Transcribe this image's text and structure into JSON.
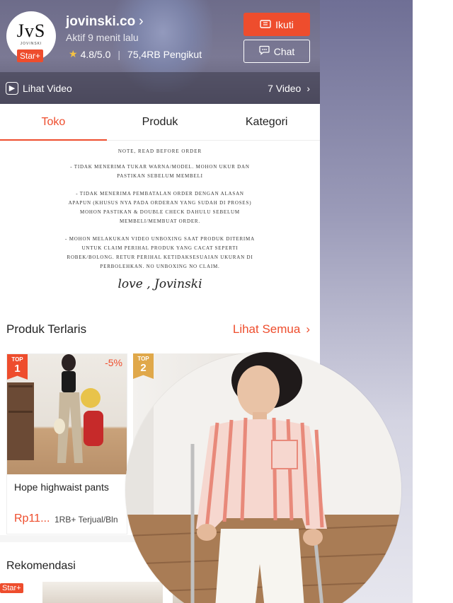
{
  "shop": {
    "logo_text": "JvS",
    "logo_sub": "JOVINSKI",
    "star_badge": "Star+",
    "name": "jovinski.co",
    "active_status": "Aktif 9 menit lalu",
    "rating": "4.8/5.0",
    "followers": "75,4RB Pengikut",
    "follow_label": "Ikuti",
    "chat_label": "Chat",
    "video_link": "Lihat Video",
    "video_count": "7 Video"
  },
  "tabs": [
    {
      "label": "Toko",
      "active": true
    },
    {
      "label": "Produk",
      "active": false
    },
    {
      "label": "Kategori",
      "active": false
    }
  ],
  "notice": {
    "title": "NOTE, READ BEFORE ORDER",
    "p1": "- TIDAK MENERIMA TUKAR WARNA/MODEL. MOHON UKUR DAN PASTIKAN SEBELUM MEMBELI",
    "p2": "- TIDAK MENERIMA PEMBATALAN ORDER DENGAN ALASAN APAPUN (KHUSUS NYA PADA ORDERAN YANG SUDAH DI PROSES) MOHON PASTIKAN & DOUBLE CHECK DAHULU SEBELUM MEMBELI/MEMBUAT ORDER.",
    "p3": "- MOHON MELAKUKAN VIDEO UNBOXING SAAT PRODUK DITERIMA UNTUK CLAIM PERIHAL PRODUK YANG CACAT SEPERTI ROBEK/BOLONG. RETUR PERIHAL KETIDAKSESUAIAN UKURAN DI PERBOLEHKAN. NO UNBOXING NO CLAIM.",
    "signature": "love , Jovinski"
  },
  "best_sellers": {
    "title": "Produk Terlaris",
    "see_all": "Lihat Semua",
    "products": [
      {
        "badge_top": "TOP",
        "badge_rank": "1",
        "discount": "-5%",
        "name": "Hope highwaist pants",
        "price": "Rp11...",
        "sold": "1RB+ Terjual/Bln"
      },
      {
        "badge_top": "TOP",
        "badge_rank": "2",
        "discount": "",
        "name": "",
        "price": "",
        "sold": ""
      }
    ]
  },
  "recommendations": {
    "title": "Rekomendasi",
    "badge": "Star+"
  },
  "colors": {
    "accent": "#ee4d2d",
    "top1_badge": "#ee4d2d",
    "top2_badge": "#e0a84a"
  }
}
